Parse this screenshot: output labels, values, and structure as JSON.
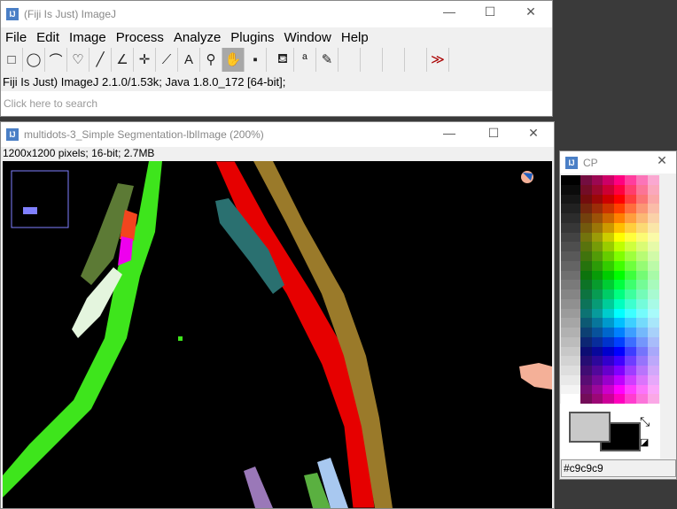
{
  "main": {
    "title": "(Fiji Is Just) ImageJ",
    "menus": [
      "File",
      "Edit",
      "Image",
      "Process",
      "Analyze",
      "Plugins",
      "Window",
      "Help"
    ],
    "tools": [
      "rectangle-tool",
      "oval-tool",
      "polygon-tool",
      "freehand-tool",
      "line-tool",
      "angle-tool",
      "point-tool",
      "wand-tool",
      "text-tool",
      "zoom-tool",
      "hand-tool",
      "color-picker-tool",
      "flood-fill-tool",
      "label-tool",
      "brush-tool",
      "empty-slot",
      "empty-slot",
      "empty-slot",
      "empty-slot",
      "more-tools"
    ],
    "tool_glyphs": [
      "□",
      "◯",
      "⌒",
      "♡",
      "╱",
      "∠",
      "✛",
      "⟋",
      "A",
      "⚲",
      "✋",
      "▪",
      "⛾",
      "ª",
      "✎",
      "",
      "",
      "",
      "",
      "≫"
    ],
    "status": "Fiji Is Just) ImageJ 2.1.0/1.53k; Java 1.8.0_172 [64-bit];",
    "search_placeholder": "Click here to search"
  },
  "image_window": {
    "title": "multidots-3_Simple Segmentation-lblImage (200%)",
    "info": "1200x1200 pixels; 16-bit; 2.7MB"
  },
  "cp": {
    "title": "CP",
    "foreground": "#c9c9c9",
    "background": "#000000",
    "value": "#c9c9c9"
  }
}
